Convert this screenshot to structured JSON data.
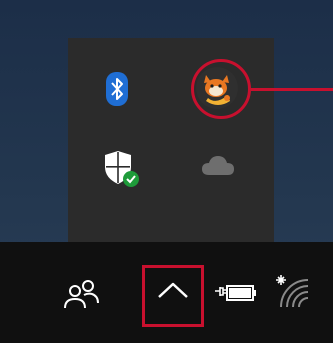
{
  "tray_flyout": {
    "icons": [
      {
        "name": "bluetooth-icon"
      },
      {
        "name": "app-mascot-icon"
      },
      {
        "name": "windows-security-icon"
      },
      {
        "name": "onedrive-cloud-icon"
      }
    ]
  },
  "taskbar": {
    "icons": [
      {
        "name": "people-icon"
      },
      {
        "name": "show-hidden-icons-chevron-icon"
      },
      {
        "name": "battery-charging-icon"
      },
      {
        "name": "wifi-no-connection-icon"
      }
    ]
  },
  "annotations": {
    "color": "#c8102e"
  },
  "colors": {
    "flyout_bg": "#2b2b2b",
    "taskbar_bg": "#101010",
    "bluetooth_blue": "#1f6ed4",
    "shield_green": "#1e9b3a",
    "cloud_gray": "#6e6e6e"
  }
}
